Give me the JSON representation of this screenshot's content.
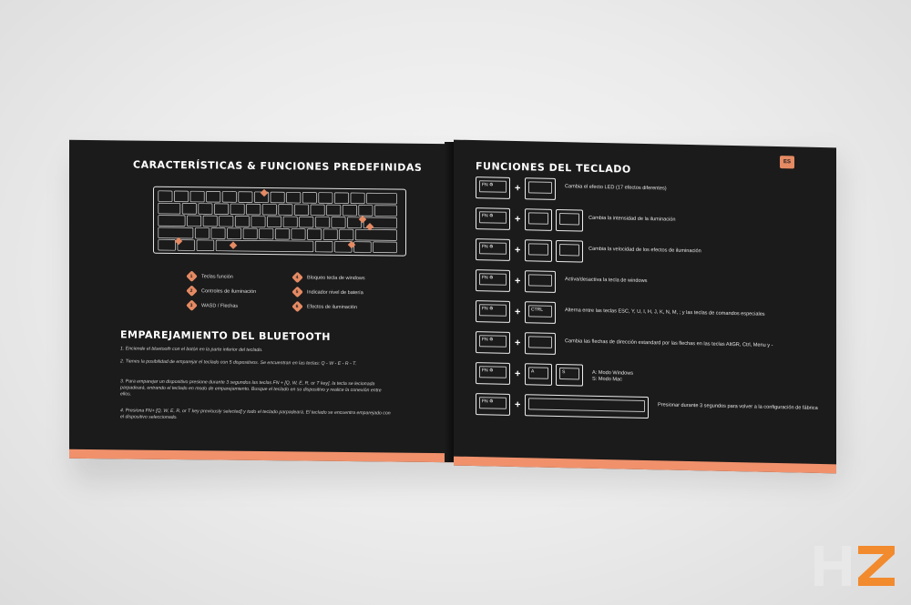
{
  "left_page": {
    "title": "CARACTERÍSTICAS  & FUNCIONES PREDEFINIDAS",
    "legend": [
      {
        "num": "1",
        "label": "Teclas función"
      },
      {
        "num": "2",
        "label": "Controles de iluminación"
      },
      {
        "num": "3",
        "label": "WASD / Flechas"
      },
      {
        "num": "4",
        "label": "Bloqueo tecla de windows"
      },
      {
        "num": "5",
        "label": "Indicador nivel de batería"
      },
      {
        "num": "6",
        "label": "Efectos de iluminación"
      }
    ],
    "bluetooth_title": "EMPAREJAMIENTO DEL BLUETOOTH",
    "steps": [
      "1. Enciende el bluetooth con el botón en la parte inferior del teclado.",
      "2. Tienes la posibilidad de emparejar el teclado con 5 dispositivos. Se encuentran en las teclas: Q - W - E - R - T.",
      "3. Para emparejar un dispositivo presione durante 3 segundos las teclas FN + [Q, W, E, R, or T key], la tecla se lecionada parpadeará, entrando el teclado en modo de emparejamiento. Busque el teclado en su dispositivo y realice la conexión entre ellos.",
      "4. Presiona FN+ [Q, W, E, R, or T key previously selected] y todo el teclado parpadeará. El teclado se encuentra emparejado con el dispositivo seleccionado."
    ]
  },
  "right_page": {
    "title": "FUNCIONES DEL TECLADO",
    "badge": "ES",
    "fn_key_label": "FN",
    "rows": [
      {
        "desc": "Cambia el efecto LED (17 efectos diferentes)"
      },
      {
        "desc": "Cambia la intensidad de la iluminación"
      },
      {
        "desc": "Cambia la velocidad de los efectos de iluminación"
      },
      {
        "desc": "Activa/desactiva la tecla de windows"
      },
      {
        "desc": "Alterna entre las teclas ESC, Y, U, I, H, J, K, N, M, ; y las teclas de comandos especiales",
        "key_label": "CTRL"
      },
      {
        "desc": "Cambia las flechas de dirección estandard por las flechas en las teclas AltGR, Ctrl, Menu y -"
      },
      {
        "desc": "A: Modo Windows\nS: Modo Mac",
        "key_labels": [
          "A",
          "S"
        ]
      },
      {
        "desc": "Presionar durante 3 segundos para volver a la configuración de fábrica"
      }
    ]
  },
  "watermark": {
    "text": "HZ",
    "colors": {
      "h": "#e8e8e8",
      "z": "#f28a2e"
    }
  }
}
